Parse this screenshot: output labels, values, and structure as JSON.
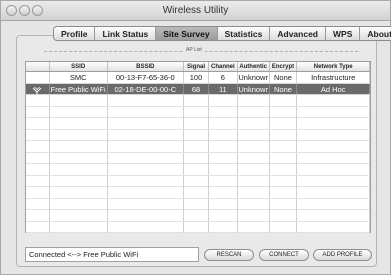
{
  "window": {
    "title": "Wireless Utility"
  },
  "tabs": [
    {
      "label": "Profile",
      "active": false
    },
    {
      "label": "Link Status",
      "active": false
    },
    {
      "label": "Site Survey",
      "active": true
    },
    {
      "label": "Statistics",
      "active": false
    },
    {
      "label": "Advanced",
      "active": false
    },
    {
      "label": "WPS",
      "active": false
    },
    {
      "label": "About",
      "active": false
    }
  ],
  "ap_list": {
    "label": "AP List",
    "columns": [
      "",
      "SSID",
      "BSSID",
      "Signal",
      "Channel",
      "Authentic",
      "Encrypt",
      "Network Type"
    ],
    "rows": [
      {
        "icon": "",
        "ssid": "SMC",
        "bssid": "00-13-F7-65-36-0",
        "signal": "100",
        "channel": "6",
        "auth": "Unknowr",
        "encrypt": "None",
        "type": "Infrastructure",
        "selected": false
      },
      {
        "icon": "adhoc-icon",
        "ssid": "Free Public WiFi",
        "bssid": "02-18-DE-00-00-C",
        "signal": "68",
        "channel": "11",
        "auth": "Unknowr",
        "encrypt": "None",
        "type": "Ad Hoc",
        "selected": true
      }
    ]
  },
  "status": {
    "text": "Connected <--> Free Public WiFi"
  },
  "buttons": {
    "rescan": "RESCAN",
    "connect": "CONNECT",
    "add_profile": "ADD PROFILE"
  },
  "colors": {
    "selected_row": "#6a6a6a",
    "active_tab": "#a8a8a8"
  }
}
